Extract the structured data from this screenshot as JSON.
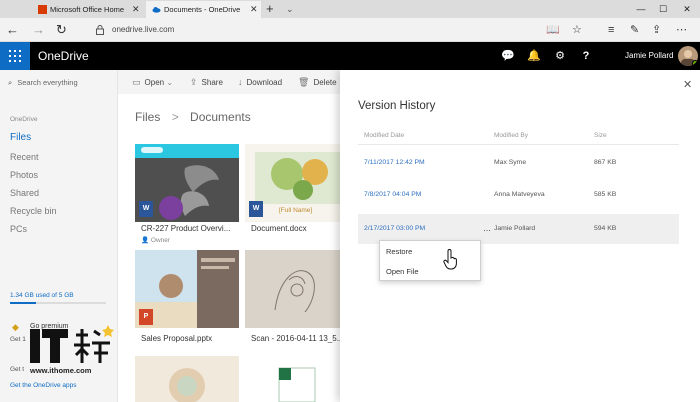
{
  "browser": {
    "tabs": [
      {
        "title": "Microsoft Office Home",
        "icon": "office-icon",
        "icon_color": "#d83b01"
      },
      {
        "title": "Documents - OneDrive",
        "icon": "onedrive-cloud-icon",
        "icon_color": "#0f6cc4"
      }
    ],
    "address": "onedrive.live.com"
  },
  "onedrive": {
    "brand": "OneDrive",
    "user_name": "Jamie Pollard",
    "brand_color": "#0f6cc4"
  },
  "sidebar": {
    "search_placeholder": "Search everything",
    "section_label": "OneDrive",
    "items": [
      {
        "label": "Files",
        "active": true
      },
      {
        "label": "Recent"
      },
      {
        "label": "Photos"
      },
      {
        "label": "Shared"
      },
      {
        "label": "Recycle bin"
      },
      {
        "label": "PCs"
      }
    ],
    "storage_text": "1.34 GB used of 5 GB",
    "storage_fraction": 0.27,
    "premium_label": "Go premium",
    "promo_line1": "Get 1",
    "promo_line2": "Get t",
    "get_apps": "Get the OneDrive apps"
  },
  "commands": {
    "open": "Open",
    "share": "Share",
    "download": "Download",
    "delete": "Delete"
  },
  "breadcrumb": {
    "root": "Files",
    "separator": ">",
    "current": "Documents"
  },
  "files": [
    {
      "name": "CR-227 Product Overvi...",
      "owner": "Owner",
      "badge": "W",
      "badge_color": "#2b579a"
    },
    {
      "name": "Document.docx",
      "thumb_text": "[Full Name]",
      "badge": "W",
      "badge_color": "#2b579a"
    },
    {
      "name": "Sales Proposal.pptx",
      "badge": "P",
      "badge_color": "#d24726"
    },
    {
      "name": "Scan - 2016-04-11 13_5...",
      "badge": "",
      "badge_color": ""
    }
  ],
  "version_history": {
    "title": "Version History",
    "columns": {
      "date": "Modified Date",
      "by": "Modified By",
      "size": "Size"
    },
    "rows": [
      {
        "date": "7/11/2017 12:42 PM",
        "by": "Max Syme",
        "size": "867 KB"
      },
      {
        "date": "7/8/2017 04:04 PM",
        "by": "Anna Matveyeva",
        "size": "585 KB"
      },
      {
        "date": "2/17/2017 03:00 PM",
        "by": "Jamie Pollard",
        "size": "594 KB"
      }
    ],
    "more_label": "...",
    "menu": [
      "Restore",
      "Open File"
    ]
  },
  "watermark": {
    "logo_text": "IT之家",
    "url": "www.ithome.com"
  }
}
